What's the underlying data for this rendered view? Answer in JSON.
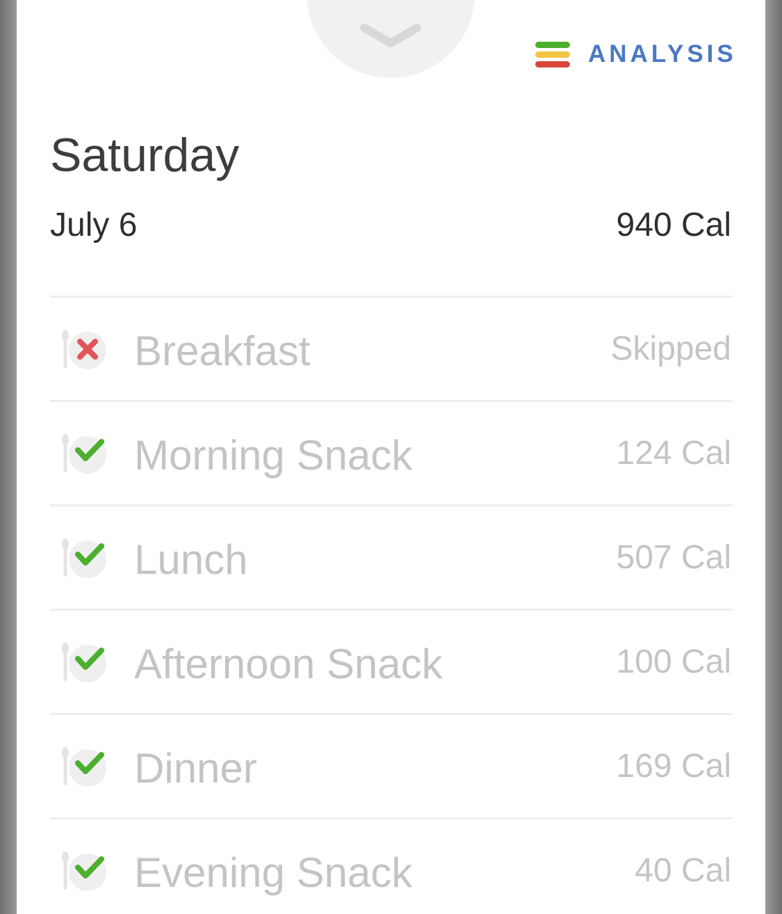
{
  "header": {
    "analysis_label": "ANALYSIS",
    "analysis_icon": "analysis-bars-icon",
    "analysis_colors": [
      "#4caf2e",
      "#f4c542",
      "#d8473a"
    ],
    "collapse_icon": "chevron-down-icon"
  },
  "day": {
    "title": "Saturday",
    "date": "July 6",
    "total": "940 Cal"
  },
  "colors": {
    "accent": "#4a78c4",
    "check": "#4caf2e",
    "skip": "#e2555b",
    "muted_text": "#c4c4c4"
  },
  "meals": [
    {
      "name": "Breakfast",
      "value": "Skipped",
      "status": "skipped",
      "icon": "cutlery-skipped-icon"
    },
    {
      "name": "Morning Snack",
      "value": "124 Cal",
      "status": "logged",
      "icon": "cutlery-check-icon"
    },
    {
      "name": "Lunch",
      "value": "507 Cal",
      "status": "logged",
      "icon": "cutlery-check-icon"
    },
    {
      "name": "Afternoon Snack",
      "value": "100 Cal",
      "status": "logged",
      "icon": "cutlery-check-icon"
    },
    {
      "name": "Dinner",
      "value": "169 Cal",
      "status": "logged",
      "icon": "cutlery-check-icon"
    },
    {
      "name": "Evening Snack",
      "value": "40 Cal",
      "status": "logged",
      "icon": "cutlery-check-icon"
    }
  ]
}
